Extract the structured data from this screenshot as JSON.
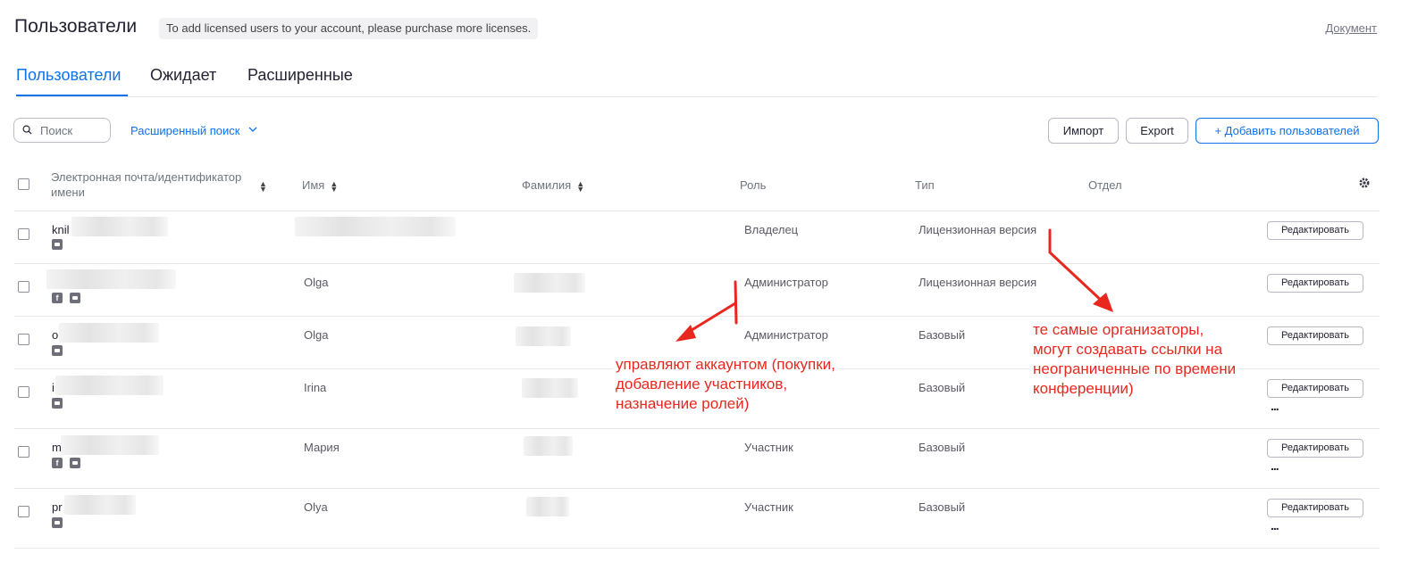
{
  "header": {
    "title": "Пользователи",
    "license_note": "To add licensed users to your account, please purchase more licenses.",
    "doc_link": "Документ"
  },
  "tabs": [
    {
      "label": "Пользователи",
      "active": true
    },
    {
      "label": "Ожидает",
      "active": false
    },
    {
      "label": "Расширенные",
      "active": false
    }
  ],
  "toolbar": {
    "search_placeholder": "Поиск",
    "advanced_search": "Расширенный поиск",
    "import_label": "Импорт",
    "export_label": "Export",
    "add_users_label": "+ Добавить пользователей"
  },
  "table": {
    "columns": {
      "email": "Электронная почта/идентификатор",
      "email_line2": "имени",
      "first_name": "Имя",
      "last_name": "Фамилия",
      "role": "Роль",
      "type": "Тип",
      "department": "Отдел"
    },
    "edit_label": "Редактировать",
    "more_label": "...",
    "rows": [
      {
        "email": "knil",
        "first_name": "",
        "last_name": "",
        "role": "Владелец",
        "type": "Лицензионная версия",
        "icons": [
          "mail-icon"
        ]
      },
      {
        "email": "",
        "first_name": "Olga",
        "last_name": "",
        "role": "Администратор",
        "type": "Лицензионная версия",
        "icons": [
          "facebook-icon",
          "mail-icon"
        ]
      },
      {
        "email": "o",
        "first_name": "Olga",
        "last_name": "",
        "role": "Администратор",
        "type": "Базовый",
        "icons": [
          "mail-icon"
        ]
      },
      {
        "email": "i",
        "first_name": "Irina",
        "last_name": "",
        "role": "",
        "type": "Базовый",
        "icons": [
          "mail-icon"
        ]
      },
      {
        "email": "m",
        "first_name": "Мария",
        "last_name": "",
        "role": "Участник",
        "type": "Базовый",
        "icons": [
          "facebook-icon",
          "mail-icon"
        ]
      },
      {
        "email": "pr",
        "first_name": "Olya",
        "last_name": "",
        "role": "Участник",
        "type": "Базовый",
        "icons": [
          "mail-icon"
        ]
      }
    ]
  },
  "annotations": {
    "admin_note": [
      "управляют аккаунтом (покупки,",
      "добавление участников,",
      "назначение ролей)"
    ],
    "license_note": [
      "те самые организаторы,",
      "могут создавать ссылки на",
      "неограниченные по времени",
      "конференции)"
    ],
    "color": "#e8281f"
  },
  "colors": {
    "accent": "#0e72ed",
    "text": "#232333",
    "muted": "#6e7680"
  }
}
